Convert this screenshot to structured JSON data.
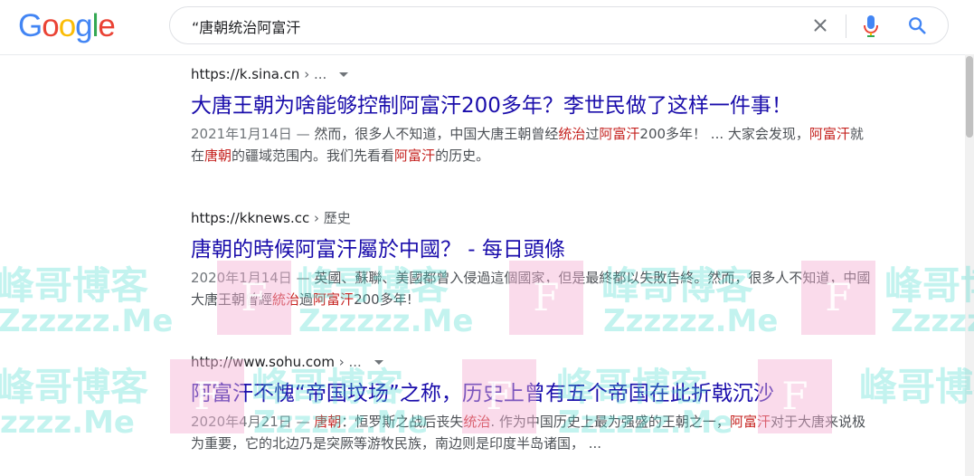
{
  "logo": {
    "letters": [
      "G",
      "o",
      "o",
      "g",
      "l",
      "e"
    ],
    "colors": [
      "#4285f4",
      "#ea4335",
      "#fbbc05",
      "#4285f4",
      "#34a853",
      "#ea4335"
    ]
  },
  "search": {
    "query": "“唐朝统治阿富汗"
  },
  "results": [
    {
      "host": "https://k.sina.cn",
      "path": " › ...",
      "title": "大唐王朝为啥能够控制阿富汗200多年？李世民做了这样一件事！",
      "snippet": [
        {
          "t": "2021年1月14日 — ",
          "k": "date"
        },
        {
          "t": "然而，很多人不知道，中国大唐王朝曾经"
        },
        {
          "t": "统治",
          "k": "hl"
        },
        {
          "t": "过"
        },
        {
          "t": "阿富汗",
          "k": "hl"
        },
        {
          "t": "200多年！ ... 大家会发现，"
        },
        {
          "t": "阿富汗",
          "k": "hl"
        },
        {
          "t": "就在"
        },
        {
          "t": "唐朝",
          "k": "hl"
        },
        {
          "t": "的疆域范围内。我们先看看"
        },
        {
          "t": "阿富汗",
          "k": "hl"
        },
        {
          "t": "的历史。"
        }
      ]
    },
    {
      "host": "https://kknews.cc",
      "path": " › 歷史",
      "title": "唐朝的時候阿富汗屬於中國？ - 每日頭條",
      "snippet": [
        {
          "t": "2020年1月14日 — ",
          "k": "date"
        },
        {
          "t": "英國、蘇聯、美國都曾入侵過這個國家，但是最終都以失敗告終。然而，很多人不知道，中國大唐王朝曾經"
        },
        {
          "t": "統治",
          "k": "hl"
        },
        {
          "t": "過"
        },
        {
          "t": "阿富汗",
          "k": "hl"
        },
        {
          "t": "200多年!"
        }
      ]
    },
    {
      "host": "http://www.sohu.com",
      "path": " › ...",
      "title": "阿富汗不愧“帝国坟场”之称，历史上曾有五个帝国在此折戟沉沙",
      "snippet": [
        {
          "t": "2020年4月21日 — ",
          "k": "date"
        },
        {
          "t": "唐朝",
          "k": "hl"
        },
        {
          "t": "：恒罗斯之战后丧失"
        },
        {
          "t": "统治",
          "k": "hl"
        },
        {
          "t": ". 作为中国历史上最为强盛的王朝之一，"
        },
        {
          "t": "阿富汗",
          "k": "hl"
        },
        {
          "t": "对于大唐来说极为重要，它的北边乃是突厥等游牧民族，南边则是印度半岛诸国， ..."
        }
      ]
    }
  ],
  "watermark": {
    "cn": "峰哥博客",
    "en": "Zzzzzz.Me",
    "en_short": "zzzz.Me",
    "box": "F"
  }
}
